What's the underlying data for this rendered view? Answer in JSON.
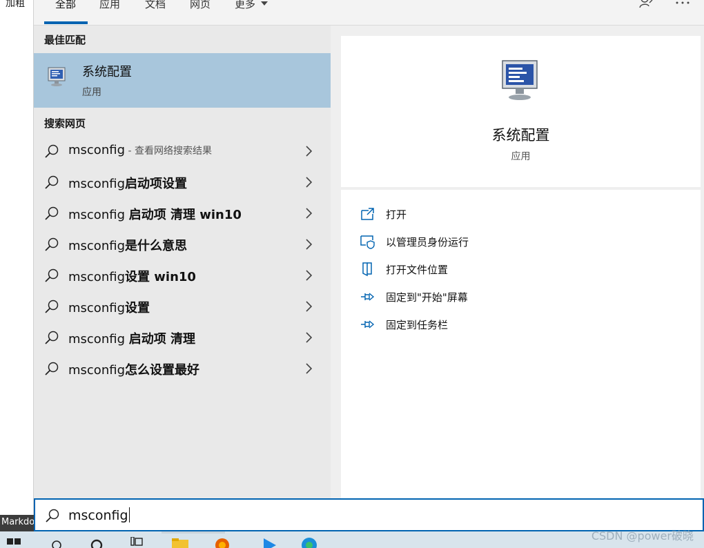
{
  "background": {
    "left_text": "加粗",
    "bottom_label": "Markdo"
  },
  "tabs": [
    {
      "label": "全部",
      "active": true
    },
    {
      "label": "应用"
    },
    {
      "label": "文档"
    },
    {
      "label": "网页"
    },
    {
      "label": "更多"
    }
  ],
  "best_match": {
    "section_title": "最佳匹配",
    "name": "系统配置",
    "type": "应用"
  },
  "web": {
    "section_title": "搜索网页",
    "results": [
      {
        "prefix": "msconfig",
        "bold": "",
        "hint": " - 查看网络搜索结果"
      },
      {
        "prefix": "msconfig",
        "bold": "启动项设置",
        "hint": ""
      },
      {
        "prefix": "msconfig ",
        "bold": "启动项 清理 win10",
        "hint": ""
      },
      {
        "prefix": "msconfig",
        "bold": "是什么意思",
        "hint": ""
      },
      {
        "prefix": "msconfig",
        "bold": "设置 win10",
        "hint": ""
      },
      {
        "prefix": "msconfig",
        "bold": "设置",
        "hint": ""
      },
      {
        "prefix": "msconfig ",
        "bold": "启动项 清理",
        "hint": ""
      },
      {
        "prefix": "msconfig",
        "bold": "怎么设置最好",
        "hint": ""
      }
    ]
  },
  "detail": {
    "title": "系统配置",
    "subtitle": "应用",
    "actions": [
      {
        "label": "打开",
        "icon": "open-icon"
      },
      {
        "label": "以管理员身份运行",
        "icon": "shield-icon"
      },
      {
        "label": "打开文件位置",
        "icon": "file-location-icon"
      },
      {
        "label": "固定到\"开始\"屏幕",
        "icon": "pin-icon"
      },
      {
        "label": "固定到任务栏",
        "icon": "pin-icon"
      }
    ]
  },
  "search": {
    "value": "msconfig"
  },
  "watermark": "CSDN @power破晓",
  "colors": {
    "accent": "#0063b1",
    "selected_bg": "#a8c6dc"
  }
}
